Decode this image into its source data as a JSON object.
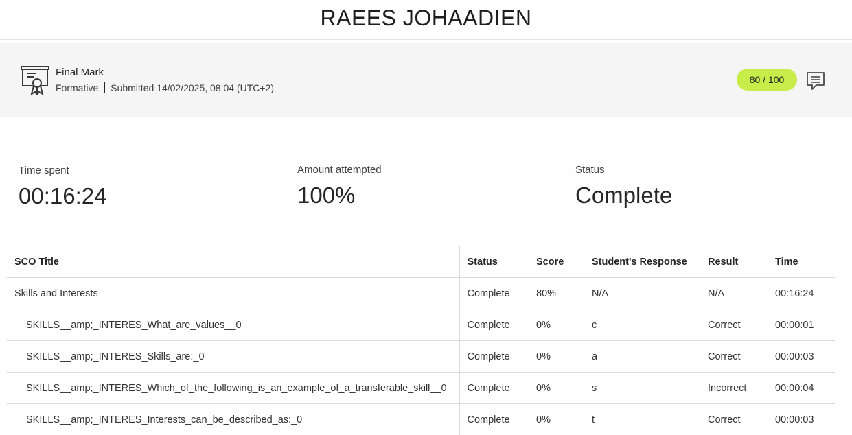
{
  "header": {
    "student_name": "RAEES JOHAADIEN"
  },
  "final_mark": {
    "title": "Final Mark",
    "type": "Formative",
    "submitted": "Submitted 14/02/2025, 08:04 (UTC+2)",
    "score": "80 / 100",
    "icon": "certificate-icon",
    "comment_icon": "comment-icon",
    "pill_color": "#c8ec4a"
  },
  "stats": {
    "time_label": "Time spent",
    "time_value": "00:16:24",
    "attempted_label": "Amount attempted",
    "attempted_value": "100%",
    "status_label": "Status",
    "status_value": "Complete"
  },
  "table": {
    "headers": [
      "SCO Title",
      "Status",
      "Score",
      "Student's Response",
      "Result",
      "Time"
    ],
    "rows": [
      [
        "Skills and Interests",
        "Complete",
        "80%",
        "N/A",
        "N/A",
        "00:16:24"
      ],
      [
        "SKILLS__amp;_INTERES_What_are_values__0",
        "Complete",
        "0%",
        "c",
        "Correct",
        "00:00:01"
      ],
      [
        "SKILLS__amp;_INTERES_Skills_are:_0",
        "Complete",
        "0%",
        "a",
        "Correct",
        "00:00:03"
      ],
      [
        "SKILLS__amp;_INTERES_Which_of_the_following_is_an_example_of_a_transferable_skill__0",
        "Complete",
        "0%",
        "s",
        "Incorrect",
        "00:00:04"
      ],
      [
        "SKILLS__amp;_INTERES_Interests_can_be_described_as:_0",
        "Complete",
        "0%",
        "t",
        "Correct",
        "00:00:03"
      ]
    ]
  }
}
